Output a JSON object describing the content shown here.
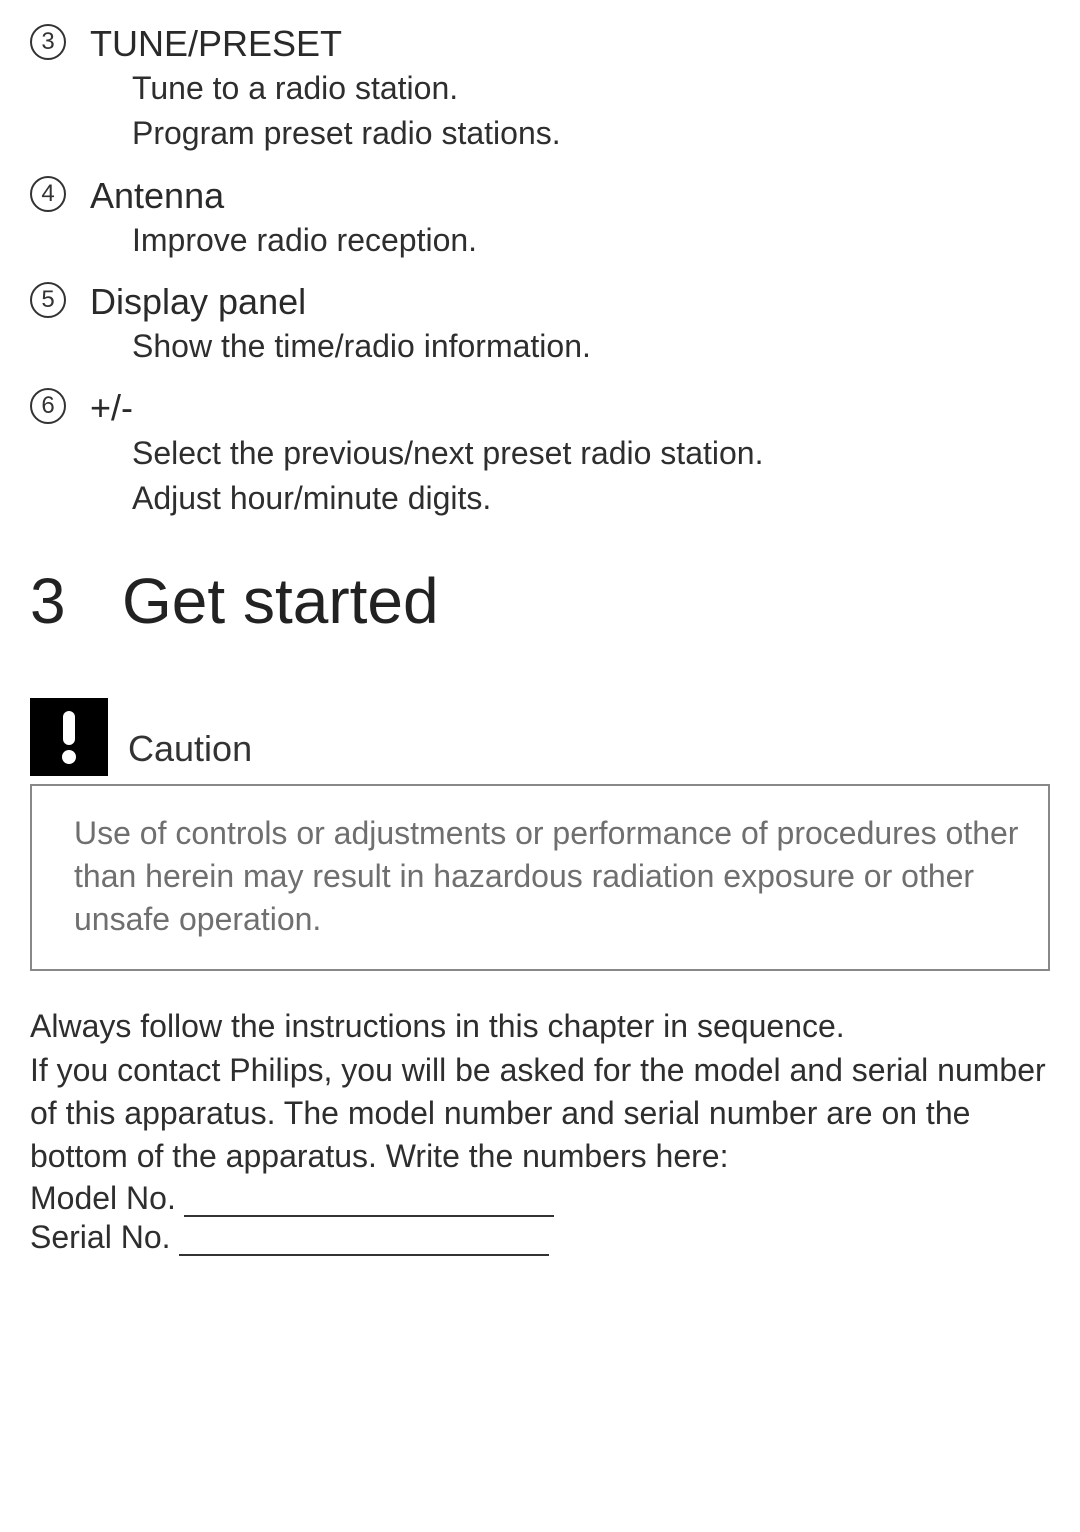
{
  "items": [
    {
      "num": "3",
      "title": "TUNE/PRESET",
      "desc": [
        "Tune to a radio station.",
        "Program preset radio stations."
      ]
    },
    {
      "num": "4",
      "title": "Antenna",
      "desc": [
        "Improve radio reception."
      ]
    },
    {
      "num": "5",
      "title": "Display panel",
      "desc": [
        "Show the time/radio information."
      ]
    },
    {
      "num": "6",
      "title": "+/-",
      "desc": [
        "Select the previous/next preset radio station.",
        "Adjust hour/minute digits."
      ]
    }
  ],
  "chapter": {
    "num": "3",
    "title": "Get started"
  },
  "caution": {
    "label": "Caution",
    "text": "Use of controls or adjustments or performance of procedures other than herein may result in hazardous radiation exposure or other unsafe operation."
  },
  "body": {
    "line1": "Always follow the instructions in this chapter in sequence.",
    "line2": "If you contact Philips, you will be asked for the model and serial number of this apparatus. The model number and serial number are on the bottom of the apparatus. Write the numbers here:",
    "model_label": "Model No.",
    "serial_label": "Serial No."
  }
}
